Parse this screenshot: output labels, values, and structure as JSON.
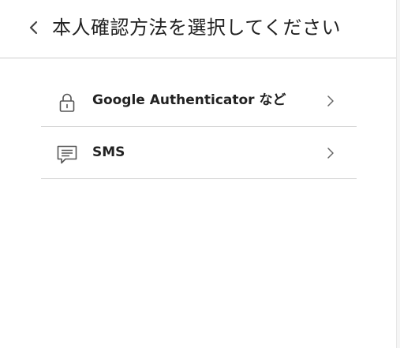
{
  "header": {
    "title": "本人確認方法を選択してください"
  },
  "methods": [
    {
      "label": "Google Authenticator など",
      "icon": "lock-icon"
    },
    {
      "label": "SMS",
      "icon": "message-icon"
    }
  ],
  "colors": {
    "text": "#222222",
    "divider": "#cfcfcf",
    "icon": "#555555"
  }
}
